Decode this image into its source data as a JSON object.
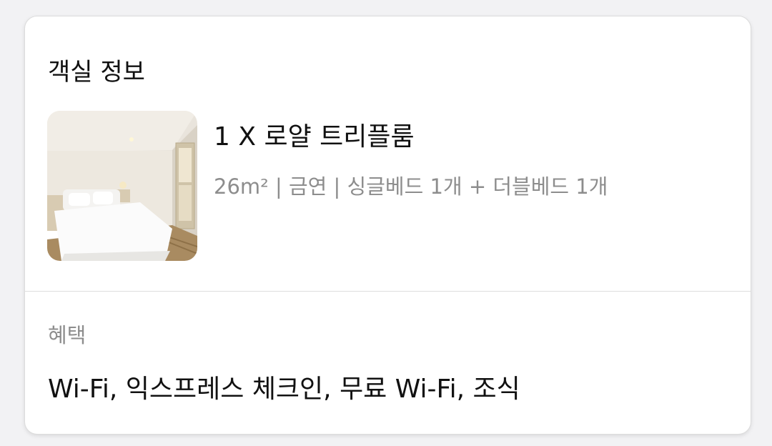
{
  "room_info": {
    "title": "객실 정보",
    "room_name": "1 X 로얄 트리플룸",
    "room_details": "26m² | 금연 | 싱글베드 1개 + 더블베드 1개",
    "image_alt": "room photo"
  },
  "benefits": {
    "label": "혜택",
    "value": "Wi-Fi, 익스프레스 체크인, 무료 Wi-Fi, 조식"
  }
}
